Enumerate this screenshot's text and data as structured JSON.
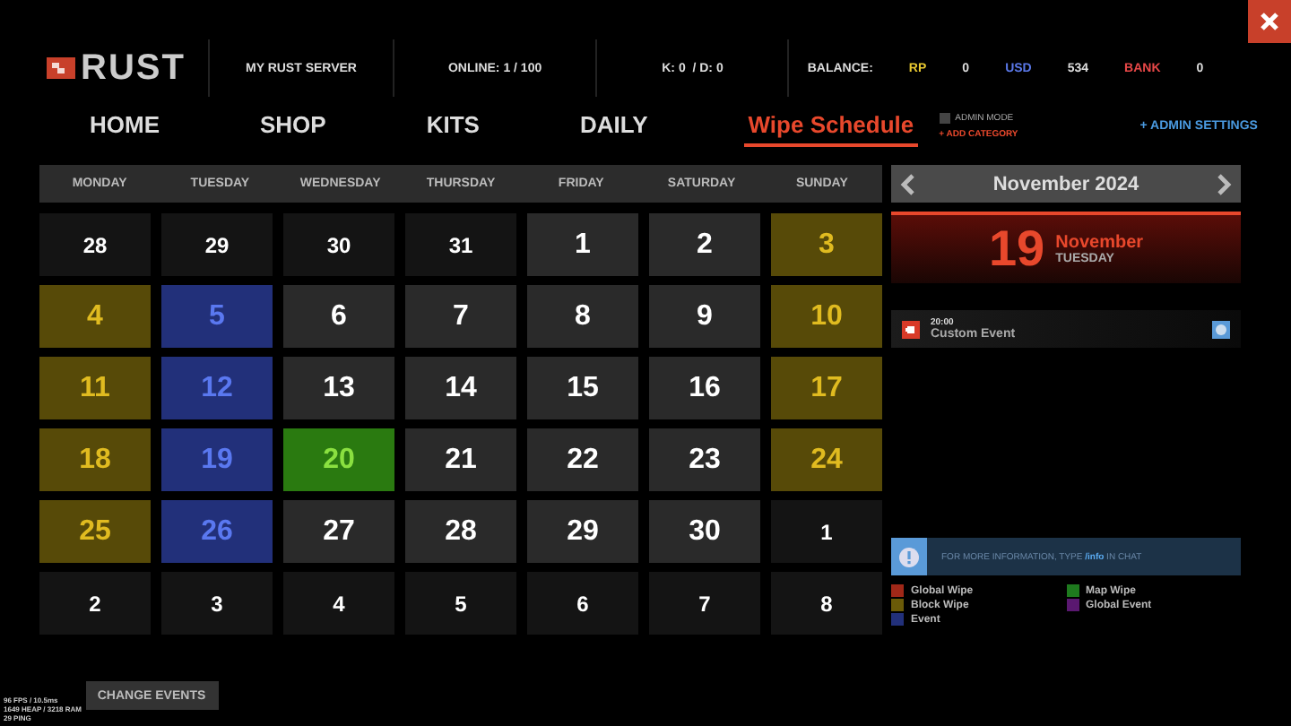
{
  "header": {
    "logo": "RUST",
    "server": "MY RUST SERVER",
    "online": "ONLINE: 1 / 100",
    "kd": "K: 0  / D: 0",
    "balance_label": "BALANCE:",
    "balances": [
      {
        "label": "RP",
        "value": "0",
        "color": "#e8c830"
      },
      {
        "label": "USD",
        "value": "534",
        "color": "#5a78e8"
      },
      {
        "label": "BANK",
        "value": "0",
        "color": "#e84848"
      }
    ]
  },
  "nav": {
    "tabs": [
      {
        "label": "HOME",
        "selected": false
      },
      {
        "label": "SHOP",
        "selected": false
      },
      {
        "label": "KITS",
        "selected": false
      },
      {
        "label": "DAILY",
        "selected": false
      },
      {
        "label": "Wipe Schedule",
        "selected": true
      }
    ],
    "admin_mode": {
      "label": "ADMIN MODE",
      "checked": false
    },
    "add_category": "+ ADD CATEGORY",
    "admin_settings": "+ ADMIN SETTINGS"
  },
  "calendar": {
    "weekdays": [
      "MONDAY",
      "TUESDAY",
      "WEDNESDAY",
      "THURSDAY",
      "FRIDAY",
      "SATURDAY",
      "SUNDAY"
    ],
    "days": [
      {
        "day": "28",
        "kind": "other"
      },
      {
        "day": "29",
        "kind": "other"
      },
      {
        "day": "30",
        "kind": "other"
      },
      {
        "day": "31",
        "kind": "other"
      },
      {
        "day": "1",
        "kind": "normal"
      },
      {
        "day": "2",
        "kind": "normal"
      },
      {
        "day": "3",
        "kind": "block"
      },
      {
        "day": "4",
        "kind": "block"
      },
      {
        "day": "5",
        "kind": "event"
      },
      {
        "day": "6",
        "kind": "normal"
      },
      {
        "day": "7",
        "kind": "normal"
      },
      {
        "day": "8",
        "kind": "normal"
      },
      {
        "day": "9",
        "kind": "normal"
      },
      {
        "day": "10",
        "kind": "block"
      },
      {
        "day": "11",
        "kind": "block"
      },
      {
        "day": "12",
        "kind": "event"
      },
      {
        "day": "13",
        "kind": "normal"
      },
      {
        "day": "14",
        "kind": "normal"
      },
      {
        "day": "15",
        "kind": "normal"
      },
      {
        "day": "16",
        "kind": "normal"
      },
      {
        "day": "17",
        "kind": "block"
      },
      {
        "day": "18",
        "kind": "block"
      },
      {
        "day": "19",
        "kind": "event"
      },
      {
        "day": "20",
        "kind": "map"
      },
      {
        "day": "21",
        "kind": "normal"
      },
      {
        "day": "22",
        "kind": "normal"
      },
      {
        "day": "23",
        "kind": "normal"
      },
      {
        "day": "24",
        "kind": "block"
      },
      {
        "day": "25",
        "kind": "block"
      },
      {
        "day": "26",
        "kind": "event"
      },
      {
        "day": "27",
        "kind": "normal"
      },
      {
        "day": "28",
        "kind": "normal"
      },
      {
        "day": "29",
        "kind": "normal"
      },
      {
        "day": "30",
        "kind": "normal"
      },
      {
        "day": "1",
        "kind": "other"
      },
      {
        "day": "2",
        "kind": "other"
      },
      {
        "day": "3",
        "kind": "other"
      },
      {
        "day": "4",
        "kind": "other"
      },
      {
        "day": "5",
        "kind": "other"
      },
      {
        "day": "6",
        "kind": "other"
      },
      {
        "day": "7",
        "kind": "other"
      },
      {
        "day": "8",
        "kind": "other"
      }
    ]
  },
  "side": {
    "month_title": "November 2024",
    "selected": {
      "day": "19",
      "month": "November",
      "weekday": "TUESDAY"
    },
    "events": [
      {
        "time": "20:00",
        "name": "Custom Event"
      }
    ],
    "info": "FOR MORE INFORMATION, TYPE **/info** IN CHAT",
    "legend": [
      {
        "label": "Global Wipe",
        "color": "#a02818"
      },
      {
        "label": "Map Wipe",
        "color": "#1e7a1e"
      },
      {
        "label": "Block Wipe",
        "color": "#6a5a08"
      },
      {
        "label": "Global Event",
        "color": "#5a1870"
      },
      {
        "label": "Event",
        "color": "#22307a"
      }
    ]
  },
  "footer": {
    "change_events": "CHANGE EVENTS",
    "stats": [
      "96 FPS / 10.5ms",
      "1649 HEAP / 3218 RAM",
      "29 PING"
    ]
  }
}
